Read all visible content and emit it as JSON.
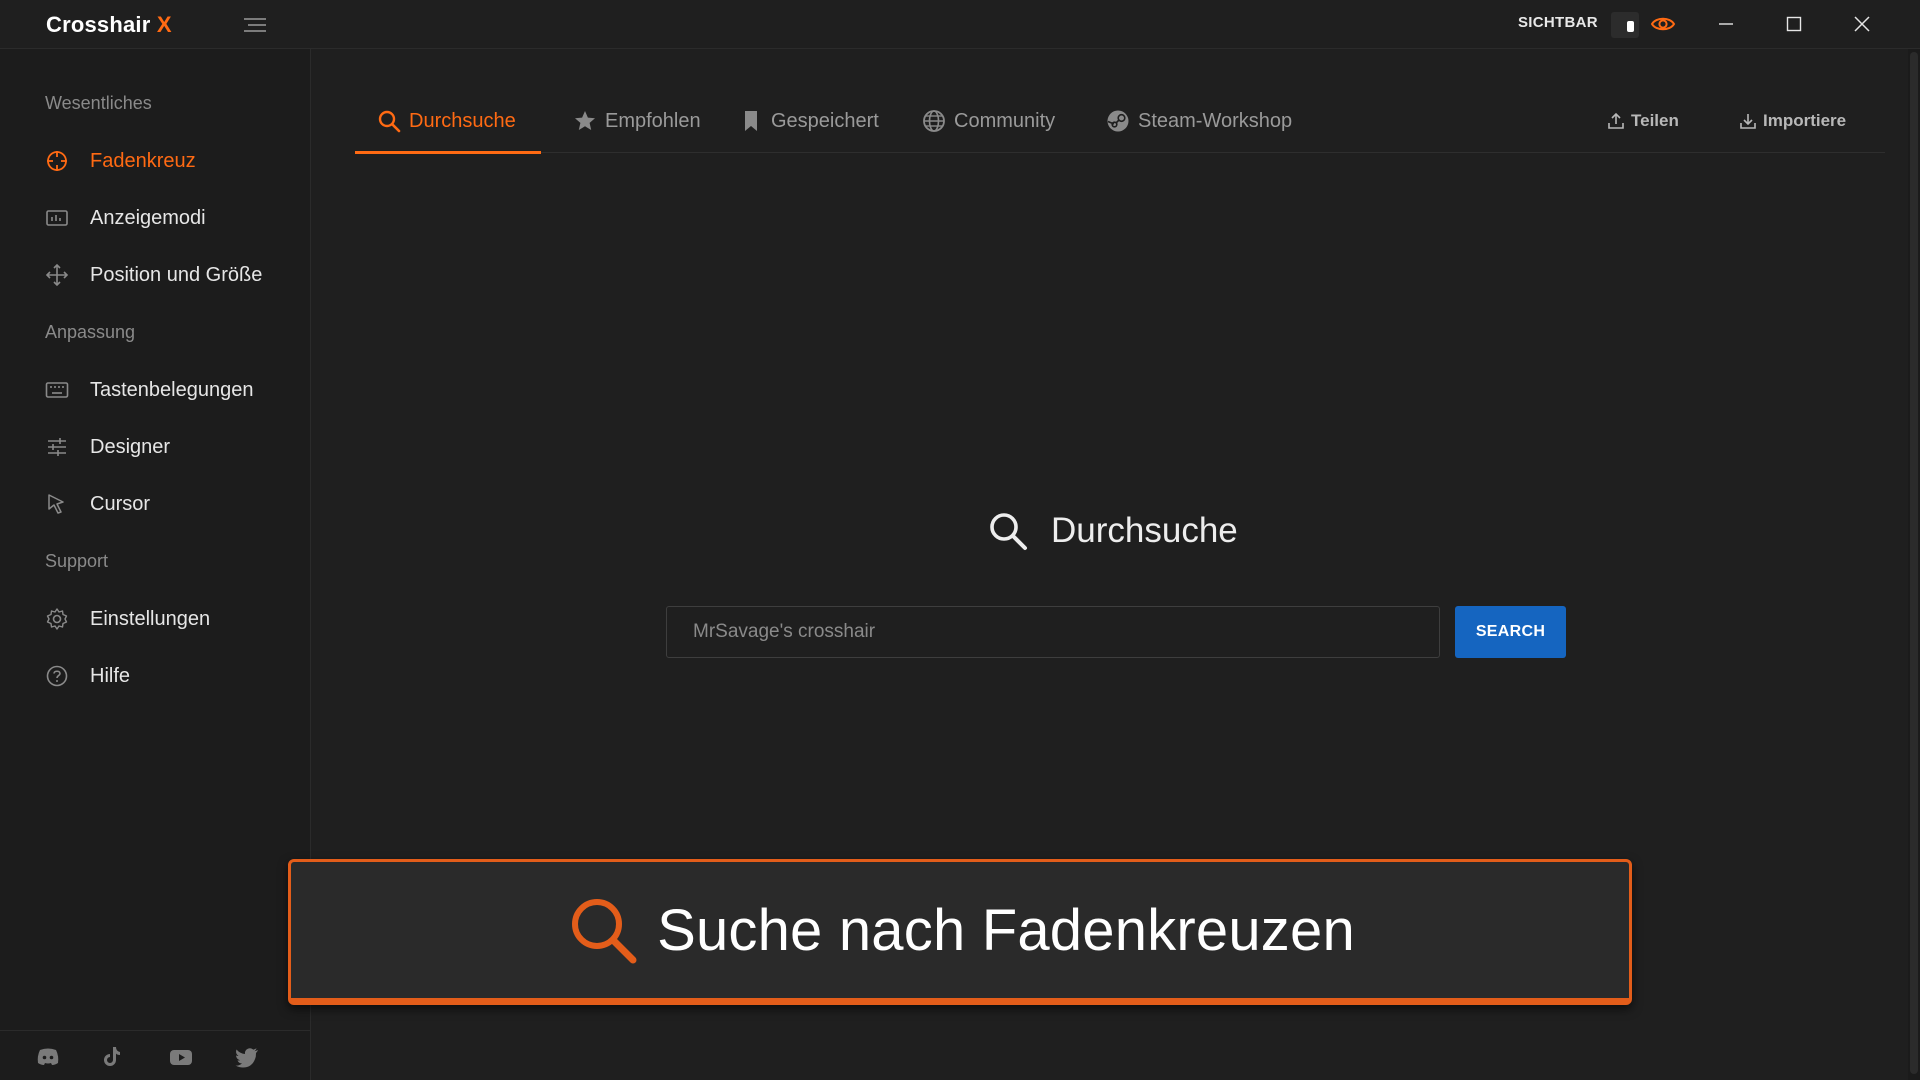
{
  "app": {
    "brand_name": "Crosshair",
    "brand_x": "X",
    "visible_label": "SICHTBAR",
    "accent_color": "#ff6a13",
    "primary_button_color": "#1565c0"
  },
  "sidebar": {
    "sections": [
      {
        "title": "Wesentliches",
        "items": [
          {
            "label": "Fadenkreuz",
            "icon": "crosshair-icon",
            "active": true
          },
          {
            "label": "Anzeigemodi",
            "icon": "display-modes-icon"
          },
          {
            "label": "Position und Größe",
            "icon": "move-icon"
          }
        ]
      },
      {
        "title": "Anpassung",
        "items": [
          {
            "label": "Tastenbelegungen",
            "icon": "keyboard-icon"
          },
          {
            "label": "Designer",
            "icon": "sliders-icon"
          },
          {
            "label": "Cursor",
            "icon": "cursor-icon"
          }
        ]
      },
      {
        "title": "Support",
        "items": [
          {
            "label": "Einstellungen",
            "icon": "gear-icon"
          },
          {
            "label": "Hilfe",
            "icon": "help-icon"
          }
        ]
      }
    ],
    "social": [
      "discord-icon",
      "tiktok-icon",
      "youtube-icon",
      "twitter-icon"
    ]
  },
  "tabs": [
    {
      "label": "Durchsuche",
      "icon": "search-icon",
      "active": true
    },
    {
      "label": "Empfohlen",
      "icon": "star-icon"
    },
    {
      "label": "Gespeichert",
      "icon": "bookmark-icon"
    },
    {
      "label": "Community",
      "icon": "globe-icon"
    },
    {
      "label": "Steam-Workshop",
      "icon": "steam-icon"
    }
  ],
  "actions": {
    "share_label": "Teilen",
    "import_label": "Importiere"
  },
  "browse": {
    "heading": "Durchsuche",
    "search_placeholder": "MrSavage's crosshair",
    "search_button": "SEARCH"
  },
  "banner": {
    "text": "Suche nach Fadenkreuzen"
  }
}
